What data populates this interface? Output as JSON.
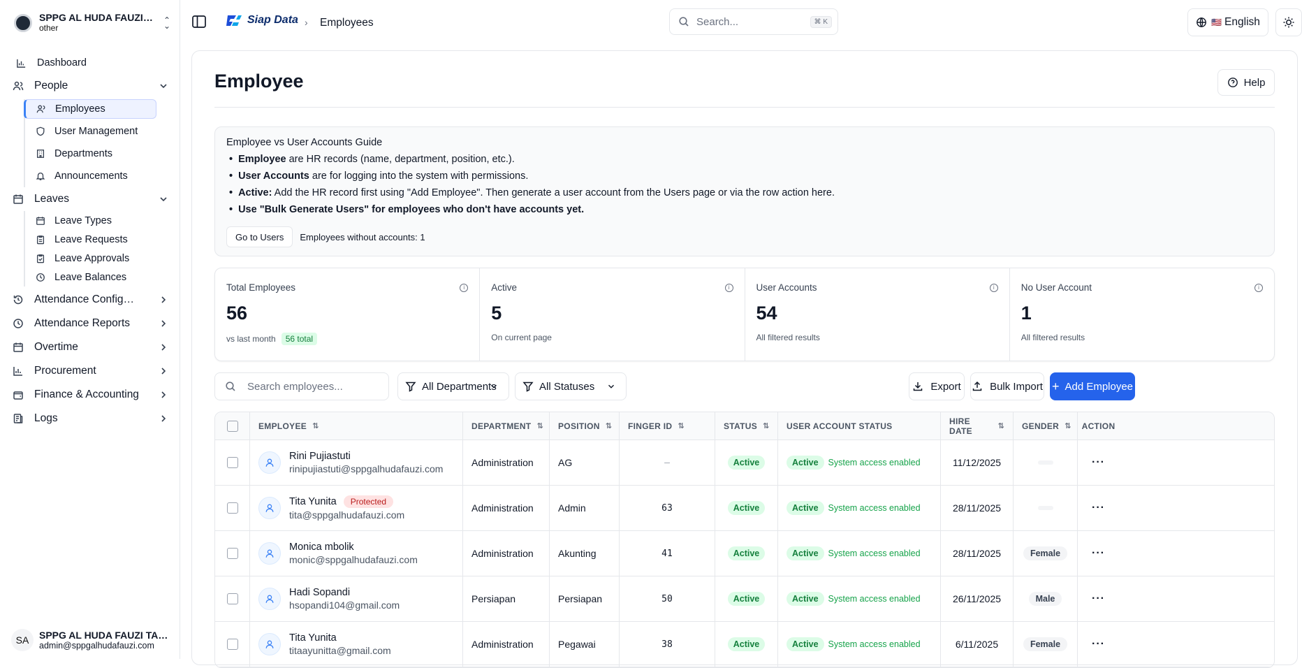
{
  "sidebar": {
    "org_name": "SPPG AL HUDA FAUZI TANGERANG",
    "org_sub": "other",
    "items": [
      {
        "label": "Dashboard"
      },
      {
        "label": "People",
        "children": [
          {
            "label": "Employees"
          },
          {
            "label": "User Management"
          },
          {
            "label": "Departments"
          },
          {
            "label": "Announcements"
          }
        ]
      },
      {
        "label": "Leaves",
        "children": [
          {
            "label": "Leave Types"
          },
          {
            "label": "Leave Requests"
          },
          {
            "label": "Leave Approvals"
          },
          {
            "label": "Leave Balances"
          }
        ]
      },
      {
        "label": "Attendance Configuration"
      },
      {
        "label": "Attendance Reports"
      },
      {
        "label": "Overtime"
      },
      {
        "label": "Procurement"
      },
      {
        "label": "Finance & Accounting"
      },
      {
        "label": "Logs"
      }
    ],
    "user": {
      "initials": "SA",
      "name": "SPPG AL HUDA FAUZI TANGERANG",
      "email": "admin@sppgalhudafauzi.com"
    }
  },
  "topbar": {
    "brand": "Siap Data",
    "breadcrumb": "Employees",
    "search_placeholder": "Search...",
    "shortcut": "⌘ K",
    "language": "English",
    "flag": "🇺🇸"
  },
  "page": {
    "title": "Employee",
    "help": "Help"
  },
  "guide": {
    "title": "Employee vs User Accounts Guide",
    "items": [
      {
        "bold": "Employee",
        "text": " are HR records (name, department, position, etc.)."
      },
      {
        "bold": "User Accounts",
        "text": " are for logging into the system with permissions."
      },
      {
        "bold": "Active:",
        "text": " Add the HR record first using \"Add Employee\". Then generate a user account from the Users page or via the row action here."
      },
      {
        "bold": "Use \"Bulk Generate Users\" for employees who don't have accounts yet.",
        "text": ""
      }
    ],
    "button": "Go to Users",
    "note": "Employees without accounts: 1"
  },
  "stats": [
    {
      "label": "Total Employees",
      "value": "56",
      "sub": "vs last month",
      "badge": "56 total"
    },
    {
      "label": "Active",
      "value": "5",
      "sub": "On current page",
      "badge": ""
    },
    {
      "label": "User Accounts",
      "value": "54",
      "sub": "All filtered results",
      "badge": ""
    },
    {
      "label": "No User Account",
      "value": "1",
      "sub": "All filtered results",
      "badge": ""
    }
  ],
  "toolbar": {
    "search_placeholder": "Search employees...",
    "dept_filter": "All Departments",
    "status_filter": "All Statuses",
    "export": "Export",
    "bulk_import": "Bulk Import",
    "add": "Add Employee"
  },
  "table": {
    "headers": [
      "EMPLOYEE",
      "DEPARTMENT",
      "POSITION",
      "FINGER ID",
      "STATUS",
      "USER ACCOUNT STATUS",
      "HIRE DATE",
      "GENDER",
      "ACTION"
    ],
    "rows": [
      {
        "name": "Rini Pujiastuti",
        "email": "rinipujiastuti@sppgalhudafauzi.com",
        "protected": "",
        "department": "Administration",
        "position": "AG",
        "finger": "—",
        "status": "Active",
        "account": "Active",
        "account_note": "System access enabled",
        "hire": "11/12/2025",
        "gender": ""
      },
      {
        "name": "Tita Yunita",
        "email": "tita@sppgalhudafauzi.com",
        "protected": "Protected",
        "department": "Administration",
        "position": "Admin",
        "finger": "63",
        "status": "Active",
        "account": "Active",
        "account_note": "System access enabled",
        "hire": "28/11/2025",
        "gender": ""
      },
      {
        "name": "Monica mbolik",
        "email": "monic@sppgalhudafauzi.com",
        "protected": "",
        "department": "Administration",
        "position": "Akunting",
        "finger": "41",
        "status": "Active",
        "account": "Active",
        "account_note": "System access enabled",
        "hire": "28/11/2025",
        "gender": "Female"
      },
      {
        "name": "Hadi Sopandi",
        "email": "hsopandi104@gmail.com",
        "protected": "",
        "department": "Persiapan",
        "position": "Persiapan",
        "finger": "50",
        "status": "Active",
        "account": "Active",
        "account_note": "System access enabled",
        "hire": "26/11/2025",
        "gender": "Male"
      },
      {
        "name": "Tita Yunita",
        "email": "titaayunitta@gmail.com",
        "protected": "",
        "department": "Administration",
        "position": "Pegawai",
        "finger": "38",
        "status": "Active",
        "account": "Active",
        "account_note": "System access enabled",
        "hire": "6/11/2025",
        "gender": "Female"
      }
    ]
  }
}
